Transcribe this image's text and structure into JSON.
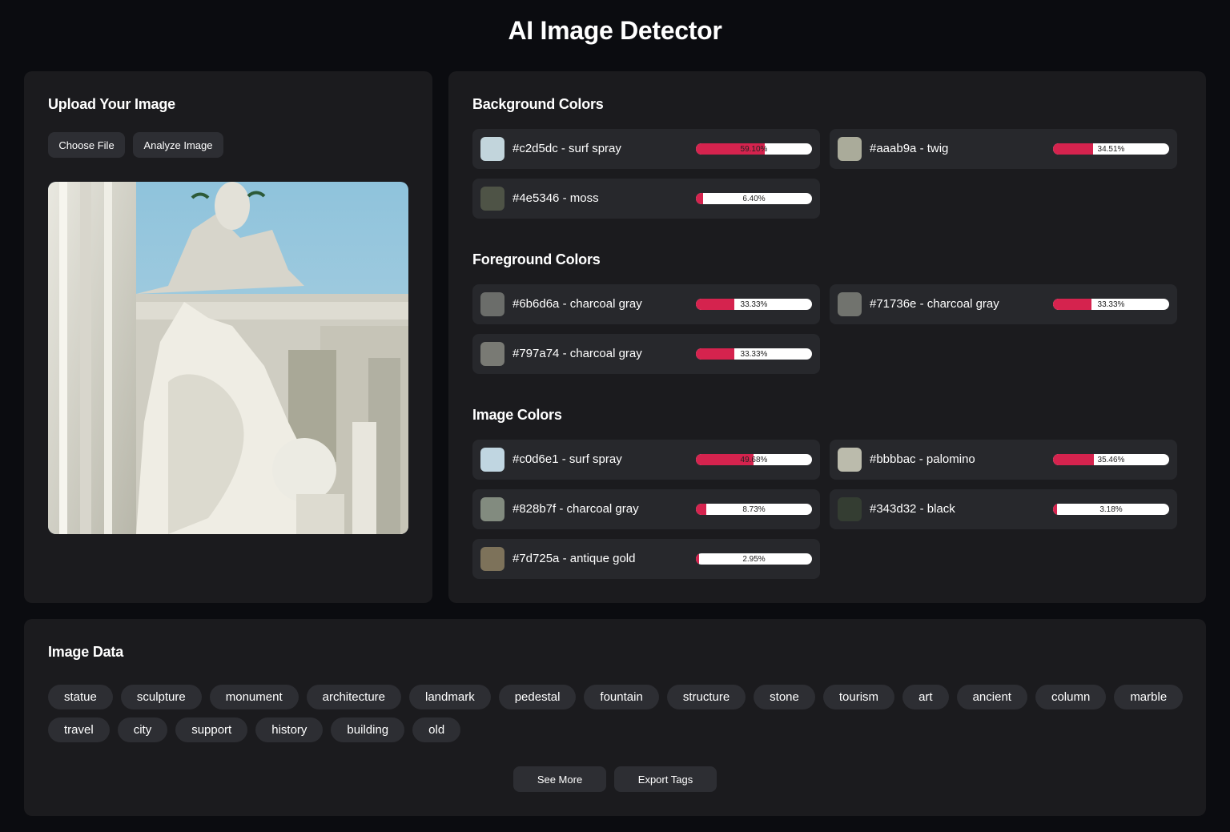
{
  "title": "AI Image Detector",
  "upload": {
    "heading": "Upload Your Image",
    "choose_label": "Choose File",
    "analyze_label": "Analyze Image"
  },
  "background": {
    "heading": "Background Colors",
    "items": [
      {
        "label": "#c2d5dc - surf spray",
        "hex": "#c2d5dc",
        "percent_text": "59.10%",
        "percent": 59.1
      },
      {
        "label": "#aaab9a - twig",
        "hex": "#aaab9a",
        "percent_text": "34.51%",
        "percent": 34.51
      },
      {
        "label": "#4e5346 - moss",
        "hex": "#4e5346",
        "percent_text": "6.40%",
        "percent": 6.4
      }
    ]
  },
  "foreground": {
    "heading": "Foreground Colors",
    "items": [
      {
        "label": "#6b6d6a - charcoal gray",
        "hex": "#6b6d6a",
        "percent_text": "33.33%",
        "percent": 33.33
      },
      {
        "label": "#71736e - charcoal gray",
        "hex": "#71736e",
        "percent_text": "33.33%",
        "percent": 33.33
      },
      {
        "label": "#797a74 - charcoal gray",
        "hex": "#797a74",
        "percent_text": "33.33%",
        "percent": 33.33
      }
    ]
  },
  "image": {
    "heading": "Image Colors",
    "items": [
      {
        "label": "#c0d6e1 - surf spray",
        "hex": "#c0d6e1",
        "percent_text": "49.68%",
        "percent": 49.68
      },
      {
        "label": "#bbbbac - palomino",
        "hex": "#bbbbac",
        "percent_text": "35.46%",
        "percent": 35.46
      },
      {
        "label": "#828b7f - charcoal gray",
        "hex": "#828b7f",
        "percent_text": "8.73%",
        "percent": 8.73
      },
      {
        "label": "#343d32 - black",
        "hex": "#343d32",
        "percent_text": "3.18%",
        "percent": 3.18
      },
      {
        "label": "#7d725a - antique gold",
        "hex": "#7d725a",
        "percent_text": "2.95%",
        "percent": 2.95
      }
    ]
  },
  "image_data": {
    "heading": "Image Data",
    "tags": [
      "statue",
      "sculpture",
      "monument",
      "architecture",
      "landmark",
      "pedestal",
      "fountain",
      "structure",
      "stone",
      "tourism",
      "art",
      "ancient",
      "column",
      "marble",
      "travel",
      "city",
      "support",
      "history",
      "building",
      "old"
    ],
    "see_more_label": "See More",
    "export_label": "Export Tags"
  },
  "colors": {
    "bar_fill": "#d5234e",
    "panel": "#1b1b1e",
    "card": "#27282c",
    "button": "#2d2e33"
  }
}
